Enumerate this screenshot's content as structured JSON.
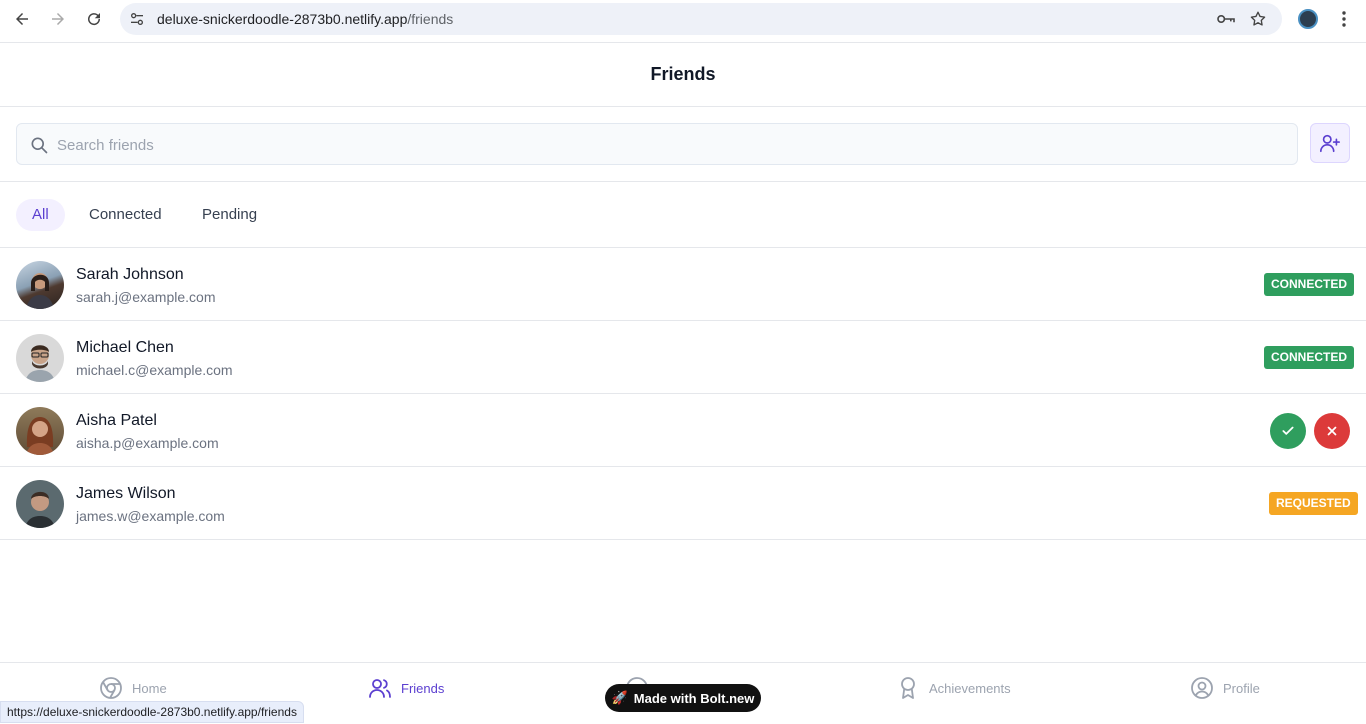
{
  "browser": {
    "url_host": "deluxe-snickerdoodle-2873b0.netlify.app",
    "url_path": "/friends",
    "status_url": "https://deluxe-snickerdoodle-2873b0.netlify.app/friends"
  },
  "header": {
    "title": "Friends"
  },
  "search": {
    "placeholder": "Search friends",
    "value": ""
  },
  "tabs": [
    {
      "label": "All",
      "active": true
    },
    {
      "label": "Connected",
      "active": false
    },
    {
      "label": "Pending",
      "active": false
    }
  ],
  "friends": [
    {
      "name": "Sarah Johnson",
      "email": "sarah.j@example.com",
      "status": "CONNECTED"
    },
    {
      "name": "Michael Chen",
      "email": "michael.c@example.com",
      "status": "CONNECTED"
    },
    {
      "name": "Aisha Patel",
      "email": "aisha.p@example.com",
      "status": ""
    },
    {
      "name": "James Wilson",
      "email": "james.w@example.com",
      "status": "REQUESTED"
    }
  ],
  "bottom_nav": [
    {
      "label": "Home",
      "icon": "chrome-icon",
      "active": false
    },
    {
      "label": "Friends",
      "icon": "users-icon",
      "active": true
    },
    {
      "label": "",
      "icon": "circle-icon",
      "active": false
    },
    {
      "label": "Achievements",
      "icon": "award-icon",
      "active": false
    },
    {
      "label": "Profile",
      "icon": "user-circle-icon",
      "active": false
    }
  ],
  "bolt_badge": {
    "label": "Made with Bolt.new"
  },
  "colors": {
    "accent": "#5b3fd0",
    "connected": "#2f9e5e",
    "requested": "#f5a623",
    "decline": "#dc3a3a"
  }
}
